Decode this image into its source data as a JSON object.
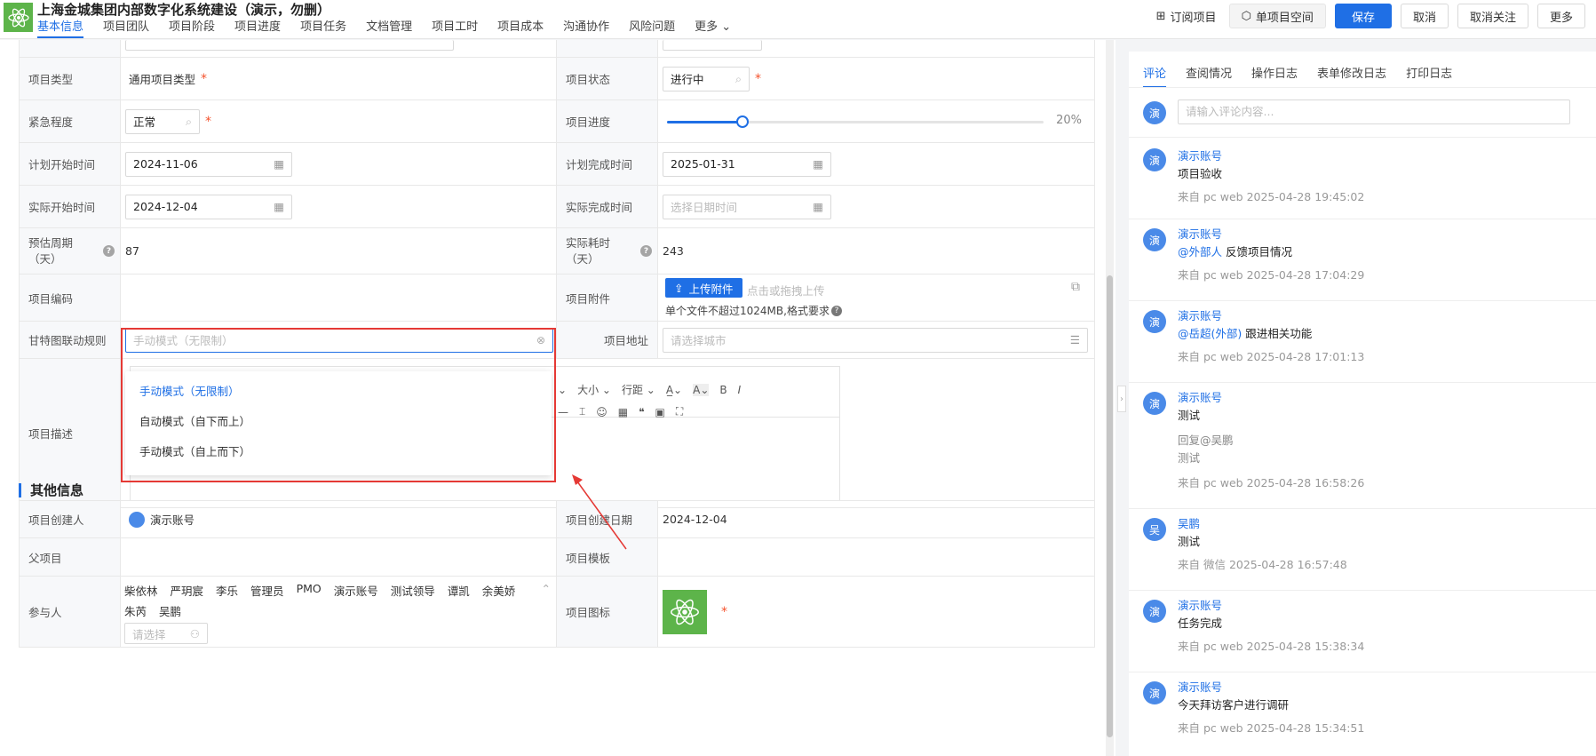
{
  "header": {
    "title": "上海金城集团内部数字化系统建设（演示，勿删）",
    "tabs": [
      "基本信息",
      "项目团队",
      "项目阶段",
      "项目进度",
      "项目任务",
      "文档管理",
      "项目工时",
      "项目成本",
      "沟通协作",
      "风险问题",
      "更多"
    ],
    "actions": {
      "subscribe": "订阅项目",
      "space": "单项目空间",
      "save": "保存",
      "cancel": "取消",
      "unfollow": "取消关注",
      "more": "更多"
    }
  },
  "form": {
    "type_label": "项目类型",
    "type_value": "通用项目类型",
    "status_label": "项目状态",
    "status_value": "进行中",
    "urgency_label": "紧急程度",
    "urgency_value": "正常",
    "progress_label": "项目进度",
    "progress_value": "20%",
    "progress_fraction": 0.2,
    "plan_start_label": "计划开始时间",
    "plan_start_value": "2024-11-06",
    "plan_end_label": "计划完成时间",
    "plan_end_value": "2025-01-31",
    "actual_start_label": "实际开始时间",
    "actual_start_value": "2024-12-04",
    "actual_end_label": "实际完成时间",
    "actual_end_placeholder": "选择日期时间",
    "est_cycle_label_1": "预估周期",
    "est_cycle_label_2": "（天）",
    "est_cycle_value": "87",
    "actual_cost_label_1": "实际耗时",
    "actual_cost_label_2": "（天）",
    "actual_cost_value": "243",
    "code_label": "项目编码",
    "attach_label": "项目附件",
    "upload_button": "上传附件",
    "upload_hint": "点击或拖拽上传",
    "upload_limit": "单个文件不超过1024MB,格式要求",
    "gantt_label": "甘特图联动规则",
    "gantt_placeholder": "手动模式（无限制）",
    "address_label": "项目地址",
    "address_placeholder": "请选择城市",
    "desc_label": "项目描述",
    "toolbar": {
      "size": "大小",
      "line_height": "行距",
      "bold": "B",
      "italic": "I"
    },
    "gantt_options": [
      "手动模式（无限制）",
      "自动模式（自下而上）",
      "手动模式（自上而下）"
    ]
  },
  "other": {
    "section_title": "其他信息",
    "creator_label": "项目创建人",
    "creator_value": "演示账号",
    "created_date_label": "项目创建日期",
    "created_date_value": "2024-12-04",
    "parent_label": "父项目",
    "template_label": "项目模板",
    "members_label": "参与人",
    "members": [
      "柴依林",
      "严玥宸",
      "李乐",
      "管理员",
      "PMO",
      "演示账号",
      "测试领导",
      "谭凯",
      "余美娇",
      "朱芮",
      "吴鹏"
    ],
    "members_placeholder": "请选择",
    "icon_label": "项目图标"
  },
  "comments": {
    "tabs": [
      "评论",
      "查阅情况",
      "操作日志",
      "表单修改日志",
      "打印日志"
    ],
    "input_placeholder": "请输入评论内容...",
    "avatar_char": "演",
    "items": [
      {
        "avatar": "演",
        "name": "演示账号",
        "mention": "",
        "text": "项目验收",
        "reply": "",
        "reply_text": "",
        "source": "来自 pc web 2025-04-28 19:45:02"
      },
      {
        "avatar": "演",
        "name": "演示账号",
        "mention": "@外部人",
        "text": " 反馈项目情况",
        "reply": "",
        "reply_text": "",
        "source": "来自 pc web 2025-04-28 17:04:29"
      },
      {
        "avatar": "演",
        "name": "演示账号",
        "mention": "@岳超(外部)",
        "text": " 跟进相关功能",
        "reply": "",
        "reply_text": "",
        "source": "来自 pc web 2025-04-28 17:01:13"
      },
      {
        "avatar": "演",
        "name": "演示账号",
        "mention": "",
        "text": "测试",
        "reply": "回复@吴鹏",
        "reply_text": "测试",
        "source": "来自 pc web 2025-04-28 16:58:26"
      },
      {
        "avatar": "吴",
        "name": "吴鹏",
        "mention": "",
        "text": "测试",
        "reply": "",
        "reply_text": "",
        "source": "来自 微信 2025-04-28 16:57:48"
      },
      {
        "avatar": "演",
        "name": "演示账号",
        "mention": "",
        "text": "任务完成",
        "reply": "",
        "reply_text": "",
        "source": "来自 pc web 2025-04-28 15:38:34"
      },
      {
        "avatar": "演",
        "name": "演示账号",
        "mention": "",
        "text": "今天拜访客户进行调研",
        "reply": "",
        "reply_text": "",
        "source": "来自 pc web 2025-04-28 15:34:51"
      }
    ]
  }
}
